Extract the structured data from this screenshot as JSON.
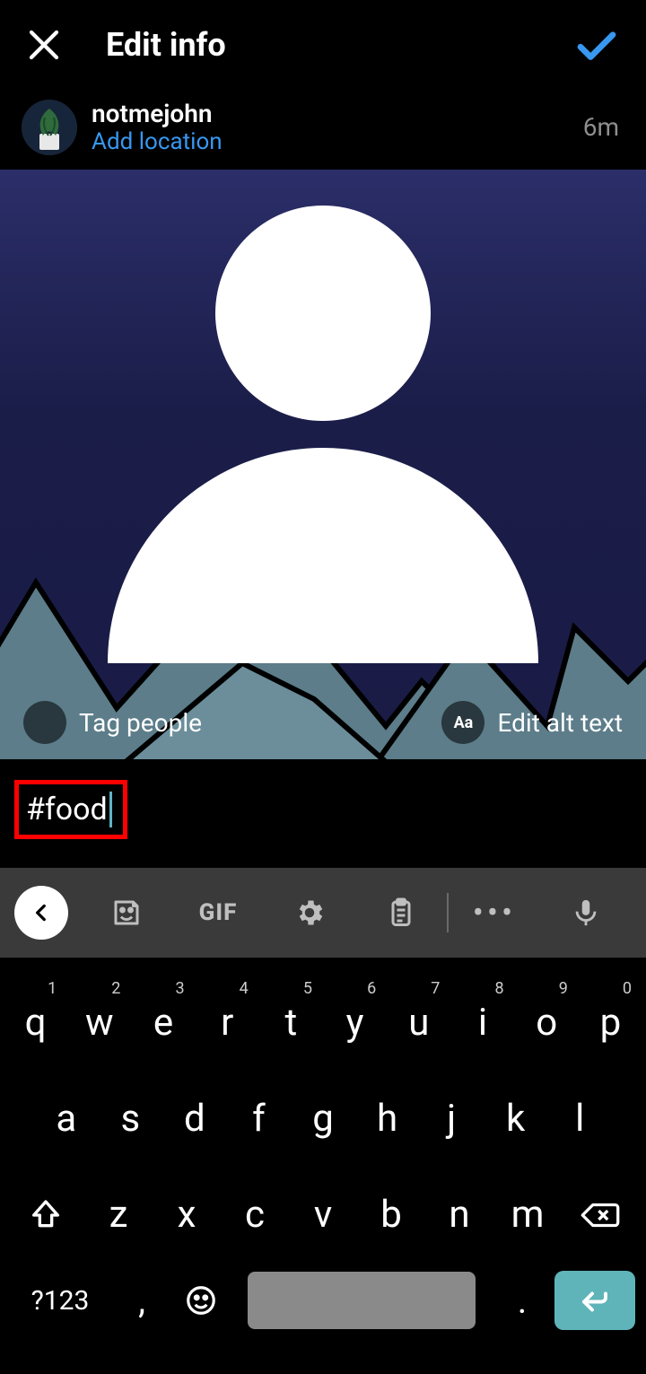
{
  "header": {
    "title": "Edit info"
  },
  "post": {
    "username": "notmejohn",
    "add_location_label": "Add location",
    "timestamp": "6m",
    "tag_people_label": "Tag people",
    "alt_text_label": "Edit alt text",
    "alt_icon_label": "Aa"
  },
  "caption": {
    "text": "#food"
  },
  "toolbar": {
    "gif_label": "GIF"
  },
  "keyboard": {
    "row1": [
      {
        "k": "q",
        "n": "1"
      },
      {
        "k": "w",
        "n": "2"
      },
      {
        "k": "e",
        "n": "3"
      },
      {
        "k": "r",
        "n": "4"
      },
      {
        "k": "t",
        "n": "5"
      },
      {
        "k": "y",
        "n": "6"
      },
      {
        "k": "u",
        "n": "7"
      },
      {
        "k": "i",
        "n": "8"
      },
      {
        "k": "o",
        "n": "9"
      },
      {
        "k": "p",
        "n": "0"
      }
    ],
    "row2": [
      "a",
      "s",
      "d",
      "f",
      "g",
      "h",
      "j",
      "k",
      "l"
    ],
    "row3": [
      "z",
      "x",
      "c",
      "v",
      "b",
      "n",
      "m"
    ],
    "symbols_label": "?123",
    "comma": ",",
    "period": "."
  }
}
